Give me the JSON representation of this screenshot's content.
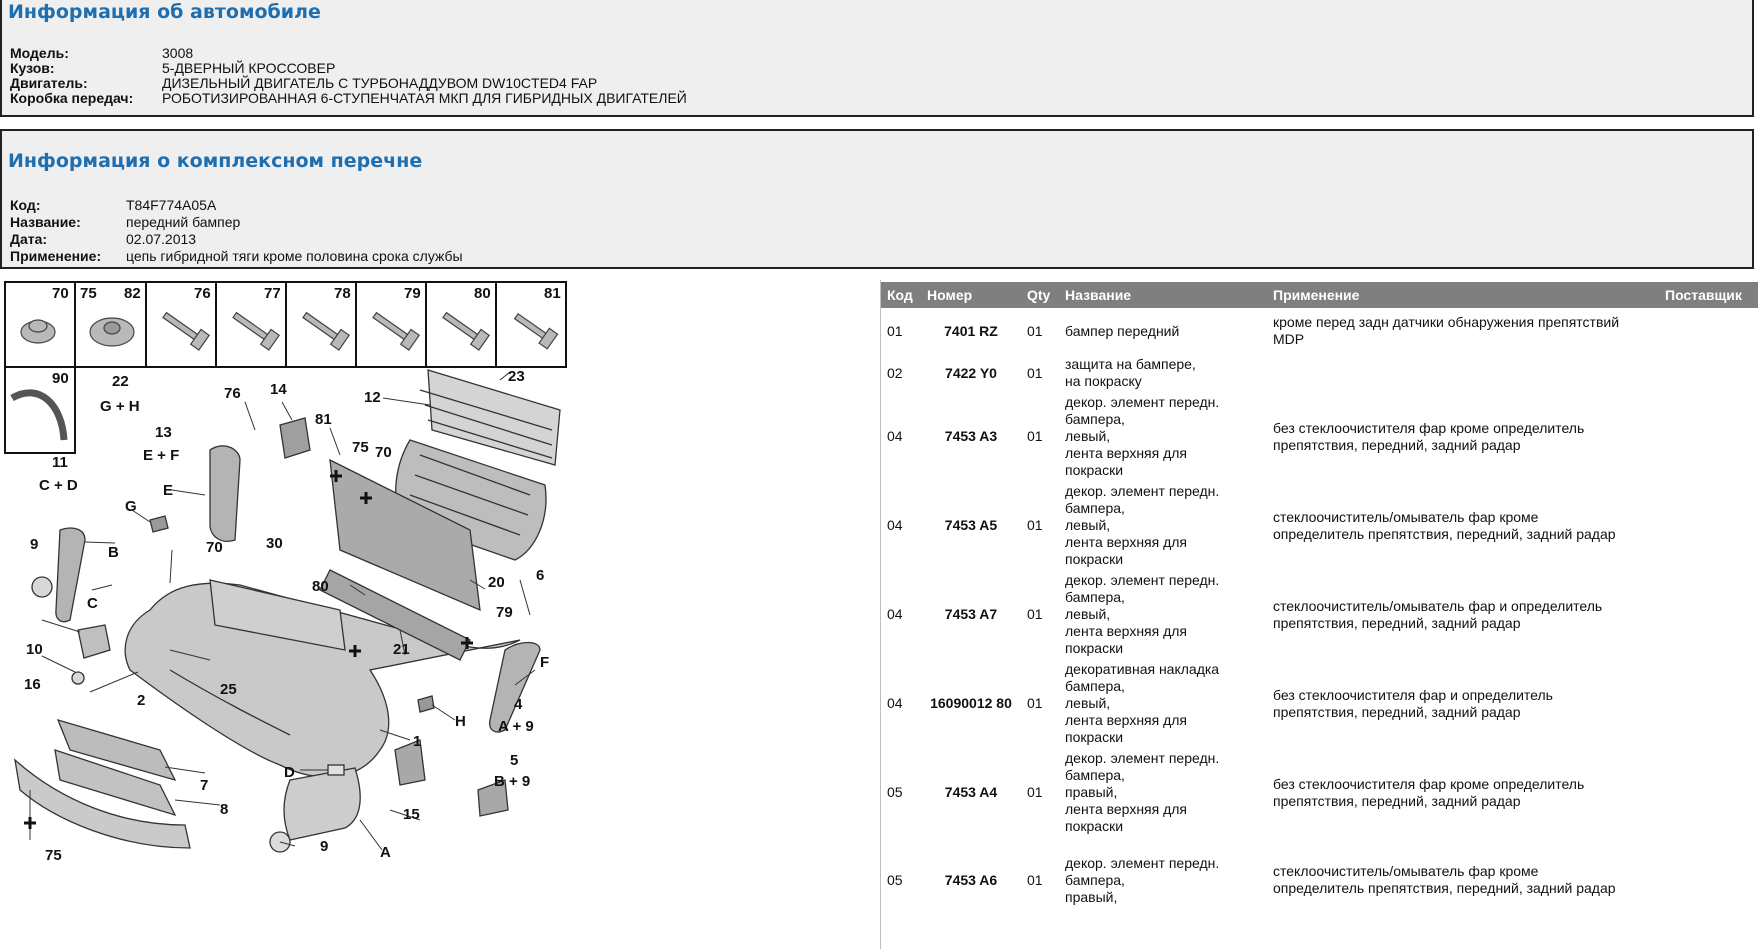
{
  "vehicle": {
    "title": "Информация об автомобиле",
    "fields": [
      {
        "label": "Модель",
        "value": "3008"
      },
      {
        "label": "Кузов",
        "value": "5-ДВЕРНЫЙ КРОССОВЕР"
      },
      {
        "label": "Двигатель",
        "value": "ДИЗЕЛЬНЫЙ ДВИГАТЕЛЬ С ТУРБОНАДДУВОМ DW10CTED4 FAP"
      },
      {
        "label": "Коробка передач",
        "value": "РОБОТИЗИРОВАННАЯ 6-СТУПЕНЧАТАЯ МКП ДЛЯ ГИБРИДНЫХ ДВИГАТЕЛЕЙ"
      }
    ]
  },
  "kit": {
    "title": "Информация о комплексном перечне",
    "fields": [
      {
        "label": "Код",
        "value": "T84F774A05A"
      },
      {
        "label": "Название",
        "value": "передний бампер"
      },
      {
        "label": "Дата",
        "value": "02.07.2013"
      },
      {
        "label": "Применение",
        "value": "цепь гибридной тяги кроме половина срока службы"
      }
    ]
  },
  "diagram": {
    "fastener_numbers": [
      "70",
      "75",
      "82",
      "76",
      "77",
      "78",
      "79",
      "80",
      "81",
      "90"
    ],
    "callouts": [
      "22",
      "G + H",
      "13",
      "E + F",
      "11",
      "C + D",
      "76",
      "14",
      "81",
      "75",
      "70",
      "12",
      "23",
      "E",
      "G",
      "70",
      "30",
      "9",
      "B",
      "C",
      "10",
      "16",
      "2",
      "25",
      "80",
      "20",
      "6",
      "79",
      "21",
      "F",
      "4",
      "A + 9",
      "H",
      "1",
      "5",
      "B + 9",
      "7",
      "8",
      "D",
      "15",
      "9",
      "A",
      "75"
    ]
  },
  "parts_table": {
    "columns": [
      "Код",
      "Номер",
      "Qty",
      "Название",
      "Применение",
      "Поставщик"
    ],
    "rows": [
      {
        "code": "01",
        "number": "7401 RZ",
        "qty": "01",
        "name": [
          "бампер передний"
        ],
        "application": [
          "кроме перед задн датчики обнаружения препятствий",
          "MDP"
        ],
        "supplier": ""
      },
      {
        "code": "02",
        "number": "7422 Y0",
        "qty": "01",
        "name": [
          "защита на бампере,",
          "на покраску"
        ],
        "application": [],
        "supplier": ""
      },
      {
        "code": "04",
        "number": "7453 A3",
        "qty": "01",
        "name": [
          "декор. элемент передн.",
          "бампера,",
          "левый,",
          "лента верхняя для",
          "покраски"
        ],
        "application": [
          "без стеклоочистителя фар кроме определитель",
          "препятствия, передний, задний радар"
        ],
        "supplier": ""
      },
      {
        "code": "04",
        "number": "7453 A5",
        "qty": "01",
        "name": [
          "декор. элемент передн.",
          "бампера,",
          "левый,",
          "лента верхняя для",
          "покраски"
        ],
        "application": [
          "стеклоочиститель/омыватель фар кроме",
          "определитель препятствия, передний, задний радар"
        ],
        "supplier": ""
      },
      {
        "code": "04",
        "number": "7453 A7",
        "qty": "01",
        "name": [
          "декор. элемент передн.",
          "бампера,",
          "левый,",
          "лента верхняя для",
          "покраски"
        ],
        "application": [
          "стеклоочиститель/омыватель фар и определитель",
          "препятствия, передний, задний радар"
        ],
        "supplier": ""
      },
      {
        "code": "04",
        "number": "16090012 80",
        "qty": "01",
        "name": [
          "декоративная накладка",
          "бампера,",
          "левый,",
          "лента верхняя для",
          "покраски"
        ],
        "application": [
          "без стеклоочистителя фар и определитель",
          "препятствия, передний, задний радар"
        ],
        "supplier": ""
      },
      {
        "code": "05",
        "number": "7453 A4",
        "qty": "01",
        "name": [
          "декор. элемент передн.",
          "бампера,",
          "правый,",
          "лента верхняя для",
          "покраски"
        ],
        "application": [
          "без стеклоочистителя фар кроме определитель",
          "препятствия, передний, задний радар"
        ],
        "supplier": ""
      },
      {
        "code": "05",
        "number": "7453 A6",
        "qty": "01",
        "name": [
          "декор. элемент передн.",
          "бампера,",
          "правый,"
        ],
        "application": [
          "стеклоочиститель/омыватель фар кроме",
          "определитель препятствия, передний, задний радар"
        ],
        "supplier": ""
      }
    ]
  }
}
